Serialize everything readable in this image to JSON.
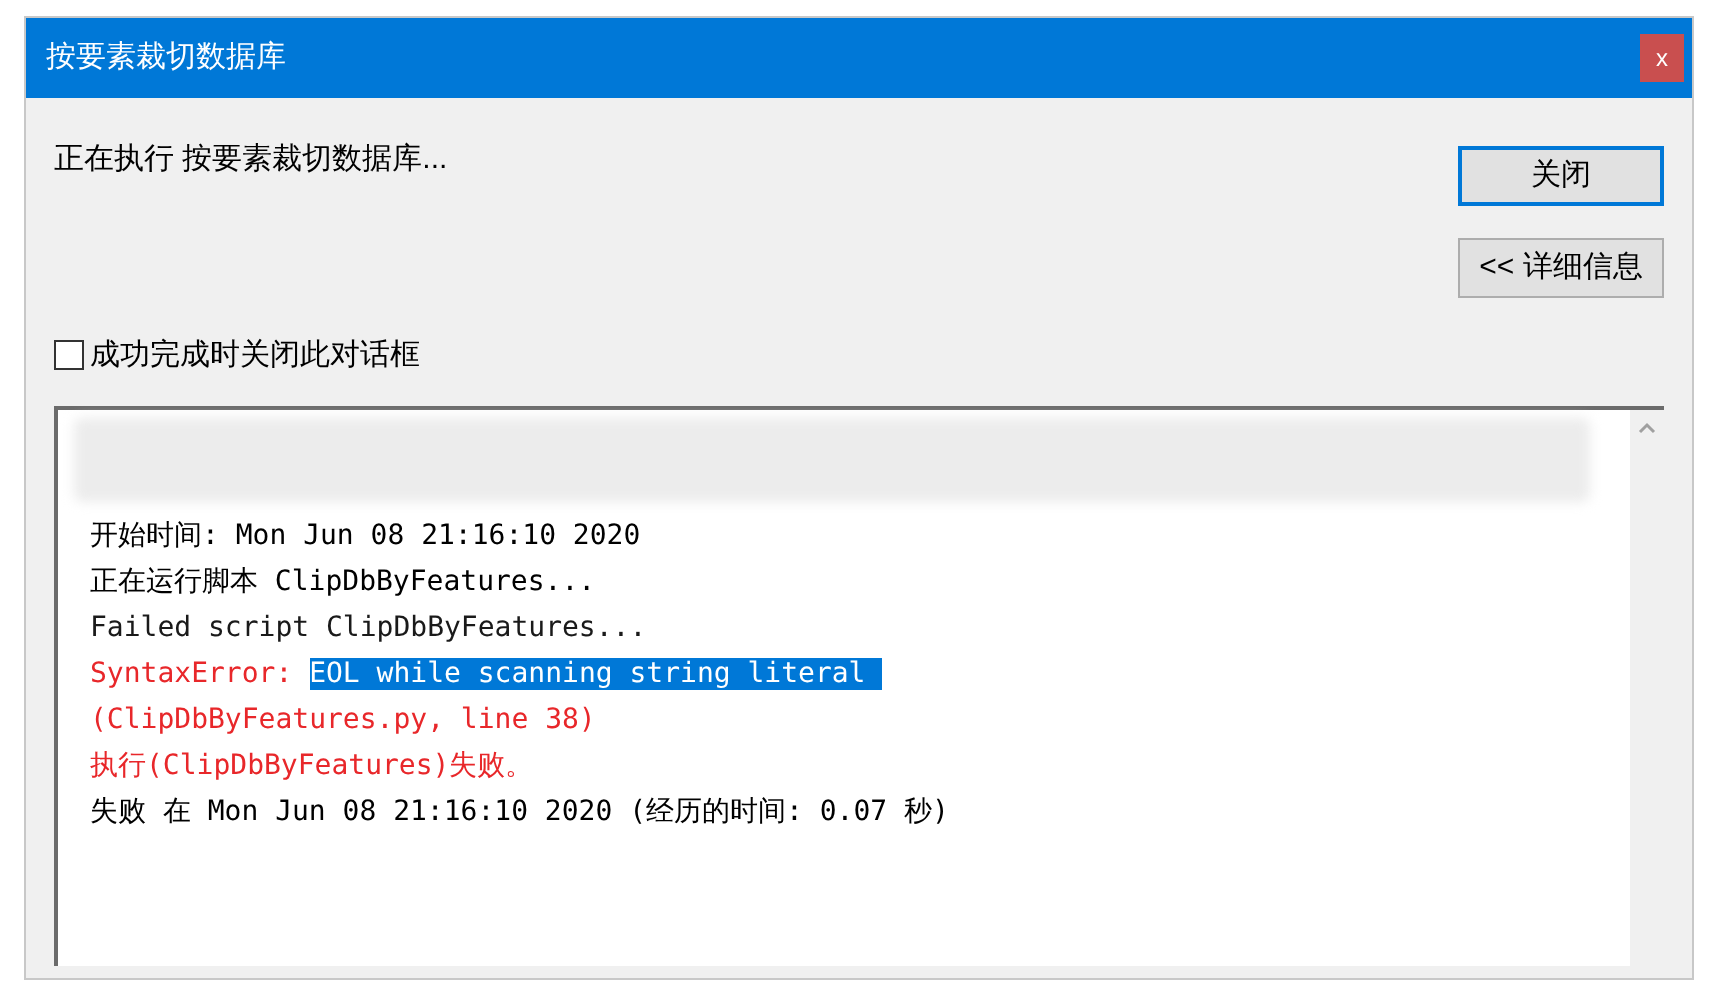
{
  "window": {
    "title": "按要素裁切数据库",
    "close_label": "x"
  },
  "status": "正在执行 按要素裁切数据库...",
  "buttons": [
    {
      "label": "关闭",
      "focused": true
    },
    {
      "label": "<< 详细信息",
      "focused": false
    }
  ],
  "close_on_success": {
    "label": "成功完成时关闭此对话框",
    "checked": false
  },
  "log": [
    {
      "color": "#000000",
      "segments": [
        {
          "text": "开始时间: Mon Jun 08 21:16:10 2020",
          "selected": false
        }
      ]
    },
    {
      "color": "#000000",
      "segments": [
        {
          "text": "正在运行脚本 ClipDbByFeatures...",
          "selected": false
        }
      ]
    },
    {
      "color": "#1a1a1a",
      "segments": [
        {
          "text": "Failed script ClipDbByFeatures...",
          "selected": false
        }
      ]
    },
    {
      "color": "#e8272a",
      "segments": [
        {
          "text": "SyntaxError: ",
          "selected": false
        },
        {
          "text": "EOL while scanning string literal ",
          "selected": true
        }
      ]
    },
    {
      "color": "#e8272a",
      "segments": [
        {
          "text": "(ClipDbByFeatures.py, line 38)",
          "selected": false
        }
      ]
    },
    {
      "color": "#e8272a",
      "segments": [
        {
          "text": "执行(ClipDbByFeatures)失败。",
          "selected": false
        }
      ]
    },
    {
      "color": "#000000",
      "segments": [
        {
          "text": "失败 在 Mon Jun 08 21:16:10 2020 (经历的时间: 0.07 秒)",
          "selected": false
        }
      ]
    }
  ]
}
